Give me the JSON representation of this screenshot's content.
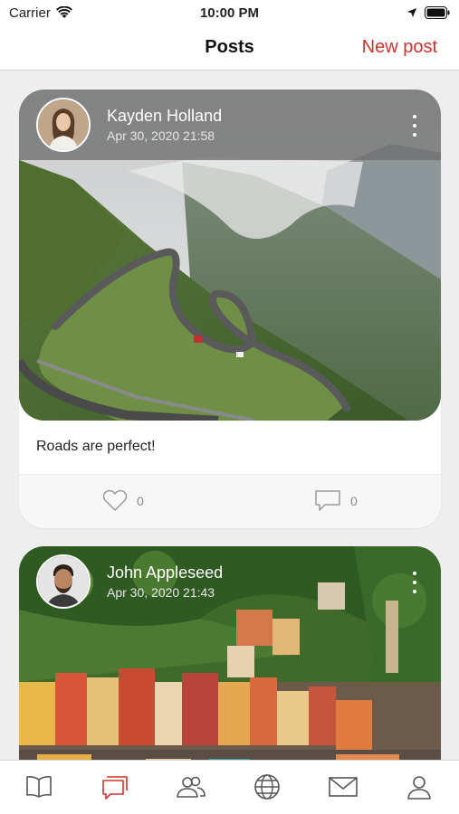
{
  "status_bar": {
    "carrier": "Carrier",
    "time": "10:00 PM"
  },
  "nav": {
    "title": "Posts",
    "new_post_label": "New post"
  },
  "posts": [
    {
      "author": "Kayden Holland",
      "date": "Apr 30, 2020 21:58",
      "text": "Roads are perfect!",
      "likes": "0",
      "comments": "0",
      "image": "mountain-road-photo"
    },
    {
      "author": "John Appleseed",
      "date": "Apr 30, 2020 21:43",
      "image": "coastal-village-photo"
    }
  ],
  "tabs": [
    {
      "icon": "book-icon",
      "active": false
    },
    {
      "icon": "chat-icon",
      "active": true
    },
    {
      "icon": "people-icon",
      "active": false
    },
    {
      "icon": "globe-icon",
      "active": false
    },
    {
      "icon": "mail-icon",
      "active": false
    },
    {
      "icon": "profile-icon",
      "active": false
    }
  ],
  "colors": {
    "accent": "#d0312d",
    "tab_inactive": "#555555",
    "icon_gray": "#9a9a9a"
  }
}
